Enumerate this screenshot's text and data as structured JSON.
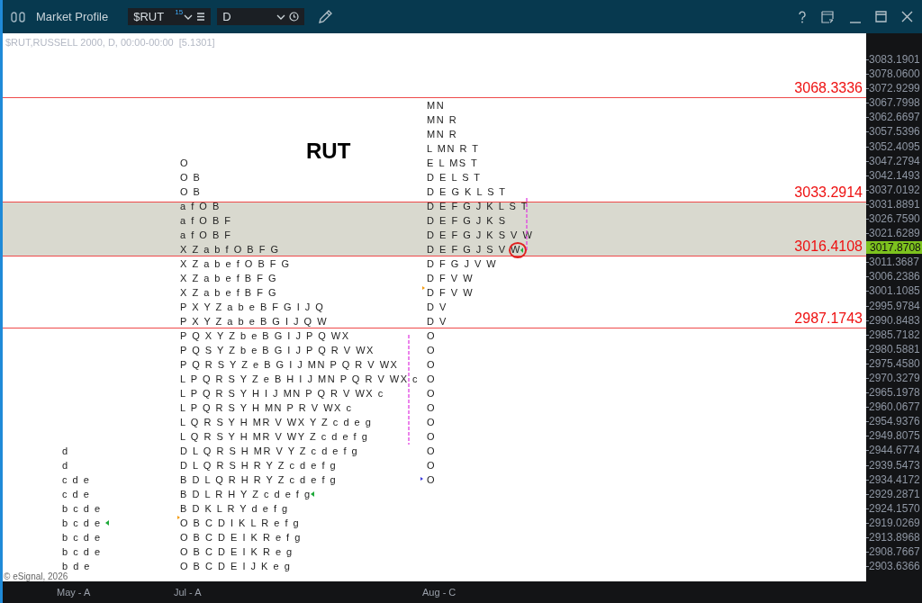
{
  "window": {
    "title": "Market Profile",
    "symbol": "$RUT",
    "symbol_badge": "15",
    "interval": "D"
  },
  "chart": {
    "info": "$RUT,RUSSELL 2000, D, 00:00-00:00  [5.1301]",
    "heading": "RUT",
    "copyright": "© eSignal, 2026",
    "levels": [
      {
        "label": "3068.3336"
      },
      {
        "label": "3033.2914"
      },
      {
        "label": "3016.4108"
      },
      {
        "label": "2987.1743"
      }
    ],
    "profiles": [
      {
        "rows": [
          "d",
          "d",
          "c d e",
          "c d e",
          "b c d e",
          "b c d e",
          "b c d e",
          "b c d e",
          "b d e"
        ]
      },
      {
        "rows": [
          "O",
          "O B",
          "O B",
          "a f O B",
          "a f O B F",
          "a f O B F",
          "X Z a b f O B F G",
          "X Z a b e f O B F G",
          "X Z a b e f B F G",
          "X Z a b e f B F G",
          "P X Y Z a b e B F G I J Q",
          "P X Y Z a b e B G I J Q W",
          "P Q X Y Z b e B G I J P Q WX",
          "P Q S Y Z b e B G I J P Q R V WX",
          "P Q R S Y Z e B G I J MN P Q R V WX",
          "L P Q R S Y Z e B H I J MN P Q R V WX c",
          "L P Q R S Y H I J MN P Q R V WX c",
          "L P Q R S Y H MN P R V WX c",
          "L Q R S Y H MR V WX Y Z c d e g",
          "L Q R S Y H MR V WY Z c d e f g",
          "D L Q R S H MR V Y Z c d e f g",
          "D L Q R S H R Y Z c d e f g",
          "B D L Q R H R Y Z c d e f g",
          "B D L R H Y Z c d e f g",
          "B D K L R Y d e f g",
          "O B C D I K L R e f g",
          "O B C D E I K R e f g",
          "O B C D E I K R e g",
          "O B C D E I J K e g"
        ]
      },
      {
        "rows": [
          "MN",
          "MN R",
          "MN R",
          "L MN R T",
          "E L MS T",
          "D E L S T",
          "D E G K L S T",
          "D E F G J K L S T",
          "D E F G J K S",
          "D E F G J K S V W",
          "D E F G J S V W",
          "D F G J V W",
          "D F V W",
          "D F V W",
          "D V",
          "D V",
          "O",
          "O",
          "O",
          "O",
          "O",
          "O",
          "O",
          "O",
          "O",
          "O",
          "O"
        ]
      }
    ],
    "price_axis": [
      {
        "label": "3083.1901",
        "kind": "tick"
      },
      {
        "label": "3078.0600",
        "kind": "tick"
      },
      {
        "label": "3072.9299",
        "kind": "tick"
      },
      {
        "label": "3067.7998",
        "kind": "tick"
      },
      {
        "label": "3062.6697",
        "kind": "tick"
      },
      {
        "label": "3057.5396",
        "kind": "tick"
      },
      {
        "label": "3052.4095",
        "kind": "tick"
      },
      {
        "label": "3047.2794",
        "kind": "tick"
      },
      {
        "label": "3042.1493",
        "kind": "tick"
      },
      {
        "label": "3037.0192",
        "kind": "tick"
      },
      {
        "label": "3031.8891",
        "kind": "tick"
      },
      {
        "label": "3026.7590",
        "kind": "tick"
      },
      {
        "label": "3021.6289",
        "kind": "tick"
      },
      {
        "label": "3017.8708",
        "kind": "current"
      },
      {
        "label": "3011.3687",
        "kind": "tick"
      },
      {
        "label": "3006.2386",
        "kind": "tick"
      },
      {
        "label": "3001.1085",
        "kind": "tick"
      },
      {
        "label": "2995.9784",
        "kind": "tick"
      },
      {
        "label": "2990.8483",
        "kind": "tick"
      },
      {
        "label": "2985.7182",
        "kind": "tick"
      },
      {
        "label": "2980.5881",
        "kind": "tick"
      },
      {
        "label": "2975.4580",
        "kind": "tick"
      },
      {
        "label": "2970.3279",
        "kind": "tick"
      },
      {
        "label": "2965.1978",
        "kind": "tick"
      },
      {
        "label": "2960.0677",
        "kind": "tick"
      },
      {
        "label": "2954.9376",
        "kind": "tick"
      },
      {
        "label": "2949.8075",
        "kind": "tick"
      },
      {
        "label": "2944.6774",
        "kind": "tick"
      },
      {
        "label": "2939.5473",
        "kind": "tick"
      },
      {
        "label": "2934.4172",
        "kind": "tick"
      },
      {
        "label": "2929.2871",
        "kind": "tick"
      },
      {
        "label": "2924.1570",
        "kind": "tick"
      },
      {
        "label": "2919.0269",
        "kind": "tick"
      },
      {
        "label": "2913.8968",
        "kind": "tick"
      },
      {
        "label": "2908.7667",
        "kind": "tick"
      },
      {
        "label": "2903.6366",
        "kind": "tick"
      }
    ],
    "time_axis": [
      "May - A",
      "Jul - A",
      "Aug - C"
    ]
  }
}
